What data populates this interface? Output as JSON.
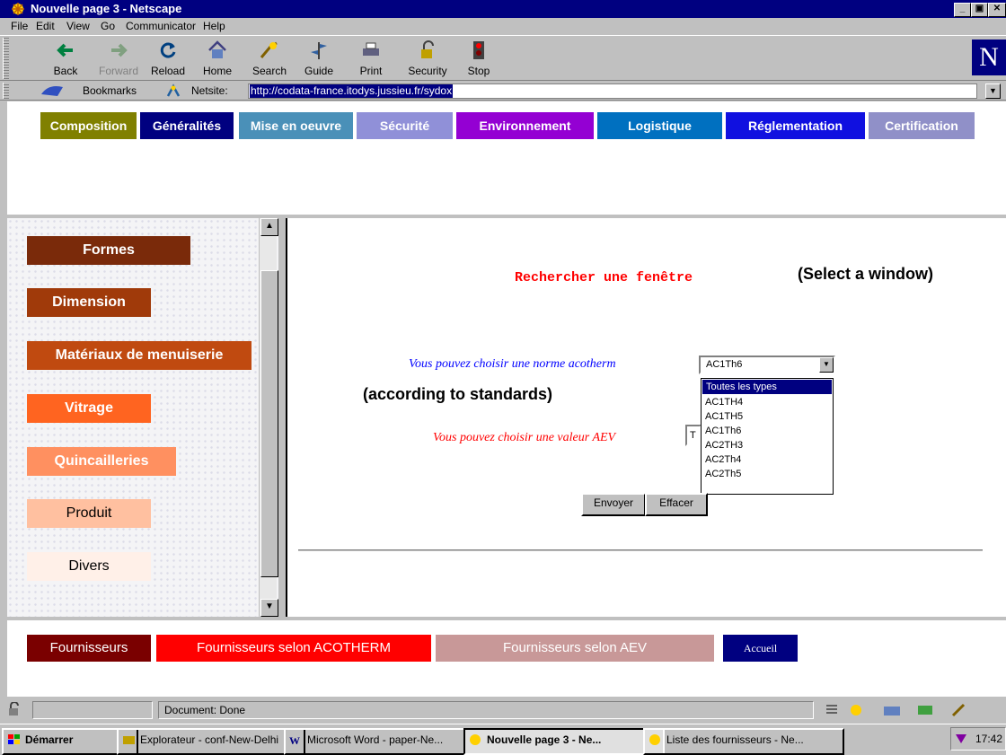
{
  "window": {
    "title": "Nouvelle page 3 - Netscape"
  },
  "menu": [
    "File",
    "Edit",
    "View",
    "Go",
    "Communicator",
    "Help"
  ],
  "toolbar": {
    "buttons": [
      {
        "label": "Back",
        "icon": "back-arrow-icon"
      },
      {
        "label": "Forward",
        "icon": "forward-arrow-icon"
      },
      {
        "label": "Reload",
        "icon": "reload-icon"
      },
      {
        "label": "Home",
        "icon": "home-icon"
      },
      {
        "label": "Search",
        "icon": "search-icon"
      },
      {
        "label": "Guide",
        "icon": "guide-icon"
      },
      {
        "label": "Print",
        "icon": "printer-icon"
      },
      {
        "label": "Security",
        "icon": "lock-icon"
      },
      {
        "label": "Stop",
        "icon": "stop-icon"
      }
    ],
    "logo": "N"
  },
  "location": {
    "bookmarks_label": "Bookmarks",
    "netsite_label": "Netsite:",
    "url": "http://codata-france.itodys.jussieu.fr/sydox"
  },
  "top_nav": [
    {
      "label": "Composition",
      "color": "#808000"
    },
    {
      "label": "Généralités",
      "color": "#000080"
    },
    {
      "label": "Mise en oeuvre",
      "color": "#4a90b8"
    },
    {
      "label": "Sécurité",
      "color": "#9090d8"
    },
    {
      "label": "Environnement",
      "color": "#9400d3"
    },
    {
      "label": "Logistique",
      "color": "#0070c0"
    },
    {
      "label": "Réglementation",
      "color": "#1010e0"
    },
    {
      "label": "Certification",
      "color": "#9090c8"
    }
  ],
  "left_menu": [
    {
      "label": "Formes",
      "bg": "#7a2a0a",
      "fg": "#ffffff"
    },
    {
      "label": "Dimension",
      "bg": "#a03a0a",
      "fg": "#ffffff"
    },
    {
      "label": "Matériaux de menuiserie",
      "bg": "#c04a10",
      "fg": "#ffffff"
    },
    {
      "label": "Vitrage",
      "bg": "#ff6420",
      "fg": "#ffffff"
    },
    {
      "label": "Quincailleries",
      "bg": "#ff9060",
      "fg": "#ffffff"
    },
    {
      "label": "Produit",
      "bg": "#ffc0a0",
      "fg": "#000000"
    },
    {
      "label": "Divers",
      "bg": "#fff0e8",
      "fg": "#000000"
    }
  ],
  "main": {
    "heading": "Rechercher une fenêtre",
    "heading_note": "(Select a window)",
    "acotherm_label": "Vous pouvez choisir une norme acotherm",
    "acotherm_selected": "AC1Th6",
    "standards_note": "(according to standards)",
    "acotherm_options": [
      "Toutes les types",
      "AC1TH4",
      "AC1TH5",
      "AC1Th6",
      "AC2TH3",
      "AC2Th4",
      "AC2Th5"
    ],
    "aev_label": "Vous pouvez choisir une valeur AEV",
    "aev_selected": "T",
    "submit_label": "Envoyer",
    "reset_label": "Effacer"
  },
  "bottom_nav": [
    {
      "label": "Fournisseurs",
      "bg": "#7a0000"
    },
    {
      "label": "Fournisseurs selon ACOTHERM",
      "bg": "#ff0000"
    },
    {
      "label": "Fournisseurs selon AEV",
      "bg": "#c89898"
    },
    {
      "label": "Accueil",
      "bg": "#000080"
    }
  ],
  "status": {
    "text": "Document: Done"
  },
  "taskbar": {
    "start": "Démarrer",
    "tasks": [
      "Explorateur - conf-New-Delhi",
      "Microsoft Word - paper-Ne...",
      "Nouvelle page 3 - Ne...",
      "Liste des fournisseurs - Ne..."
    ],
    "clock": "17:42"
  }
}
